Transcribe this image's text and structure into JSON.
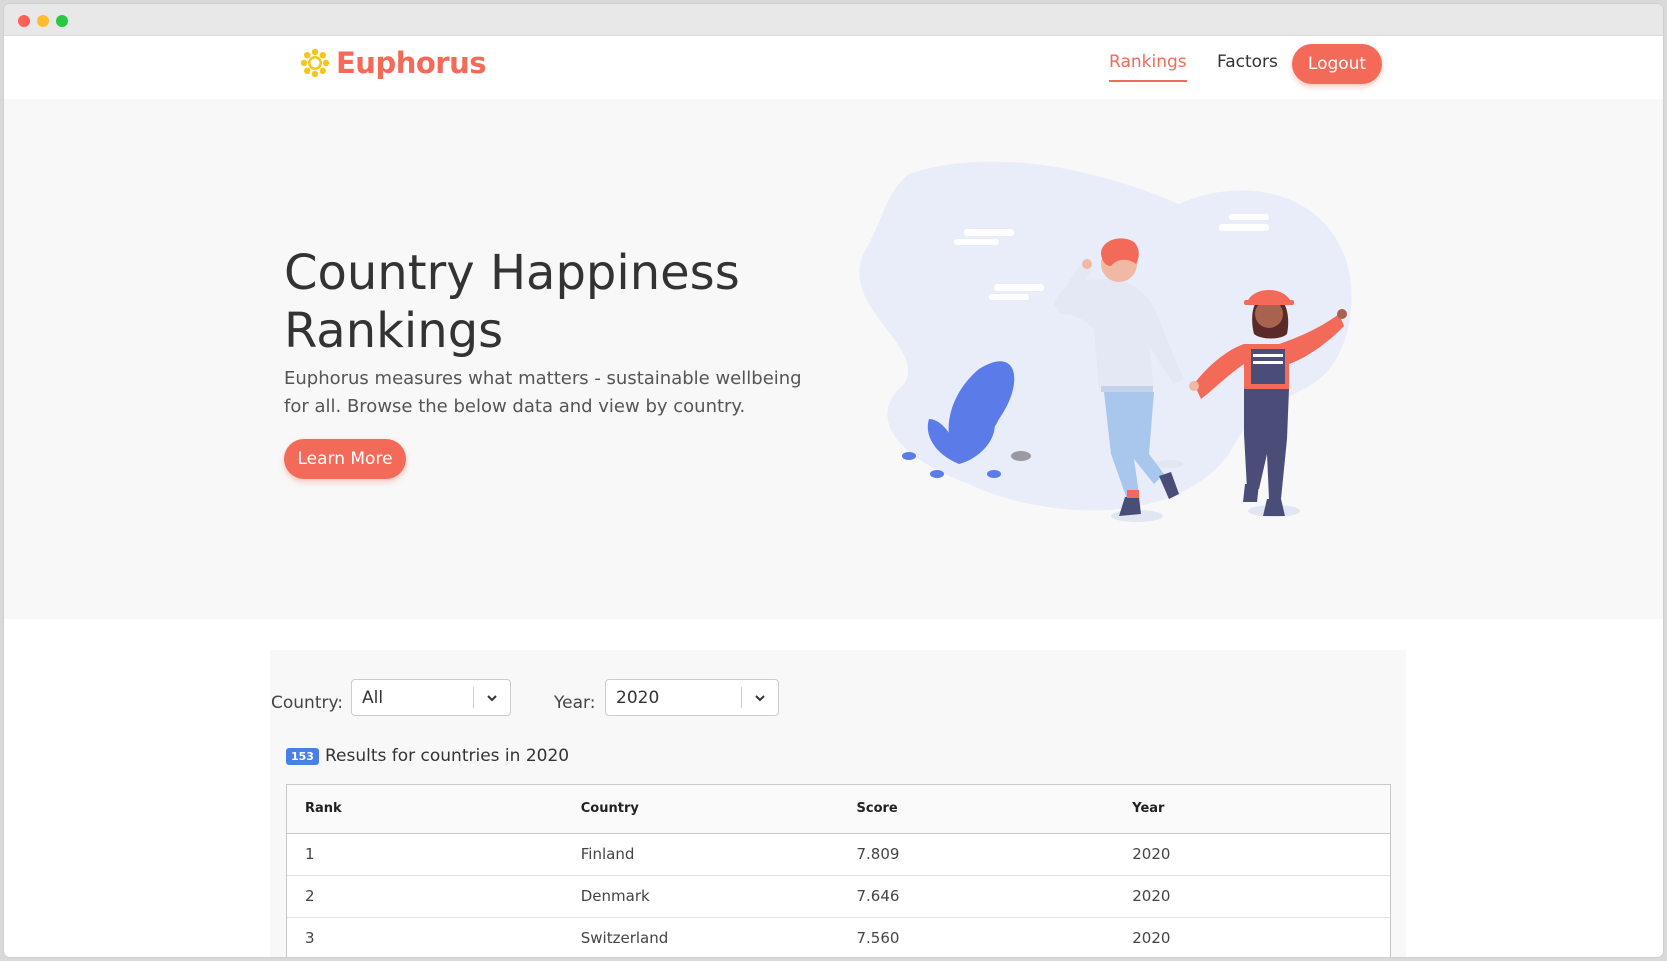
{
  "brand": {
    "name": "Euphorus",
    "accent": "#f36a59"
  },
  "nav": {
    "rankings": "Rankings",
    "factors": "Factors",
    "logout": "Logout"
  },
  "hero": {
    "title": "Country Happiness Rankings",
    "subtitle": "Euphorus measures what matters - sustainable wellbeing for all. Browse the below data and view by country.",
    "cta": "Learn More"
  },
  "filters": {
    "country_label": "Country:",
    "country_value": "All",
    "year_label": "Year:",
    "year_value": "2020"
  },
  "results": {
    "count": "153",
    "text": "Results for countries in 2020"
  },
  "table": {
    "headers": [
      "Rank",
      "Country",
      "Score",
      "Year"
    ],
    "rows": [
      [
        "1",
        "Finland",
        "7.809",
        "2020"
      ],
      [
        "2",
        "Denmark",
        "7.646",
        "2020"
      ],
      [
        "3",
        "Switzerland",
        "7.560",
        "2020"
      ]
    ]
  }
}
